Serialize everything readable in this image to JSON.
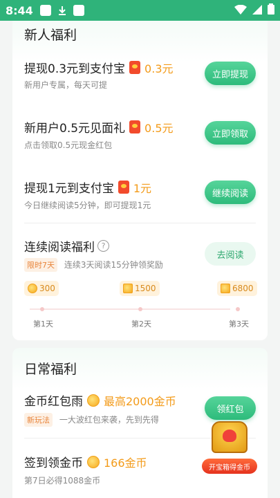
{
  "status_bar": {
    "time": "8:44"
  },
  "new_user_section": {
    "title": "新人福利",
    "items": [
      {
        "title": "提现0.3元到支付宝",
        "reward": "0.3元",
        "subtitle": "新用户专属，每天可提",
        "button": "立即提现"
      },
      {
        "title": "新用户0.5元见面礼",
        "reward": "0.5元",
        "subtitle": "点击领取0.5元现金红包",
        "button": "立即领取"
      },
      {
        "title": "提现1元到支付宝",
        "reward": "1元",
        "subtitle": "今日继续阅读5分钟，即可提现1元",
        "button": "继续阅读"
      }
    ],
    "reading_bonus": {
      "title": "连续阅读福利",
      "help_icon": "question-icon",
      "tag": "限时7天",
      "subtitle": "连续3天阅读15分钟领奖励",
      "button": "去阅读",
      "milestones": [
        {
          "value": "300",
          "day": "第1天"
        },
        {
          "value": "1500",
          "day": "第2天"
        },
        {
          "value": "6800",
          "day": "第3天"
        }
      ]
    }
  },
  "daily_section": {
    "title": "日常福利",
    "items": [
      {
        "title": "金币红包雨",
        "reward": "最高2000金币",
        "tag": "新玩法",
        "subtitle": "一大波红包来袭，先到先得",
        "button": "领红包"
      },
      {
        "title": "签到领金币",
        "reward": "166金币",
        "subtitle": "第7日必得1088金币"
      }
    ]
  },
  "floating_chest": {
    "label": "开宝箱得金币"
  },
  "colors": {
    "primary": "#2fb37a",
    "reward": "#f39b1a",
    "red_packet": "#f24b2c"
  }
}
